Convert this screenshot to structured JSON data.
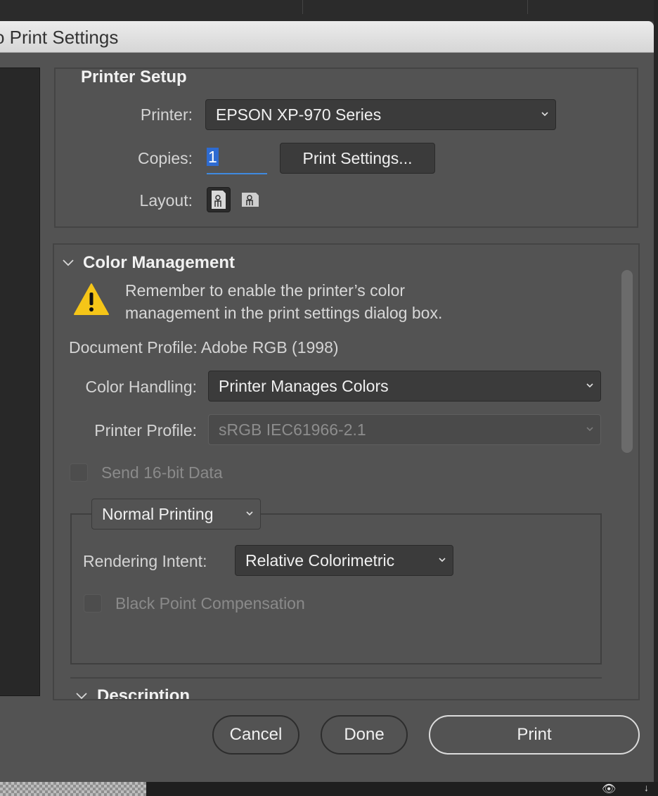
{
  "window": {
    "title": "o Print Settings"
  },
  "printer_setup": {
    "title": "Printer Setup",
    "printer_label": "Printer:",
    "printer_value": "EPSON XP-970 Series",
    "copies_label": "Copies:",
    "copies_value": "1",
    "print_settings_button": "Print Settings...",
    "layout_label": "Layout:"
  },
  "color_management": {
    "title": "Color Management",
    "warning_line1": "Remember to enable the printer’s color",
    "warning_line2": "management in the print settings dialog box.",
    "document_profile": "Document Profile: Adobe RGB (1998)",
    "color_handling_label": "Color Handling:",
    "color_handling_value": "Printer Manages Colors",
    "printer_profile_label": "Printer Profile:",
    "printer_profile_value": "sRGB IEC61966-2.1",
    "send16_label": "Send 16-bit Data",
    "printing_mode": "Normal Printing",
    "rendering_intent_label": "Rendering Intent:",
    "rendering_intent_value": "Relative Colorimetric",
    "bpc_label": "Black Point Compensation"
  },
  "description": {
    "title": "Description"
  },
  "buttons": {
    "cancel": "Cancel",
    "done": "Done",
    "print": "Print"
  },
  "colors": {
    "accent": "#2e6bd1",
    "warning": "#f5c518",
    "dialog_bg": "#535353"
  }
}
